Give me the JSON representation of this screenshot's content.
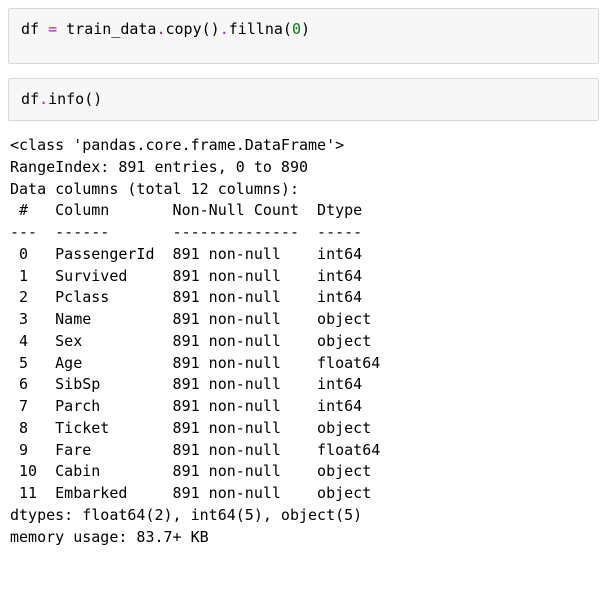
{
  "cell1": {
    "t1": "df ",
    "t2": "=",
    "t3": " train_data",
    "t4": ".",
    "t5": "copy()",
    "t6": ".",
    "t7": "fillna(",
    "t8": "0",
    "t9": ")"
  },
  "cell2": {
    "t1": "df",
    "t2": ".",
    "t3": "info()"
  },
  "info_output": "<class 'pandas.core.frame.DataFrame'>\nRangeIndex: 891 entries, 0 to 890\nData columns (total 12 columns):\n #   Column       Non-Null Count  Dtype  \n---  ------       --------------  -----  \n 0   PassengerId  891 non-null    int64  \n 1   Survived     891 non-null    int64  \n 2   Pclass       891 non-null    int64  \n 3   Name         891 non-null    object \n 4   Sex          891 non-null    object \n 5   Age          891 non-null    float64\n 6   SibSp        891 non-null    int64  \n 7   Parch        891 non-null    int64  \n 8   Ticket       891 non-null    object \n 9   Fare         891 non-null    float64\n 10  Cabin        891 non-null    object \n 11  Embarked     891 non-null    object \ndtypes: float64(2), int64(5), object(5)\nmemory usage: 83.7+ KB"
}
